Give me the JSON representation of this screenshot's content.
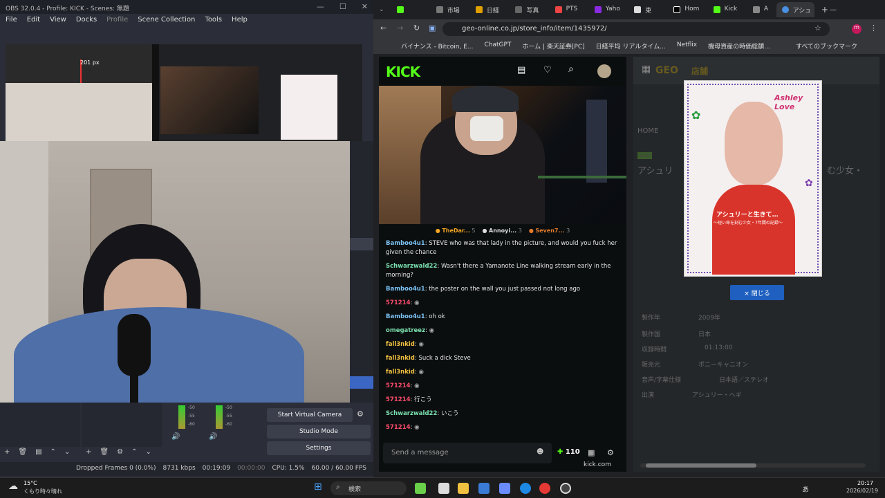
{
  "obs": {
    "title": "OBS 32.0.4 - Profile: KICK - Scenes: 無題",
    "menu": [
      "File",
      "Edit",
      "View",
      "Docks",
      "Profile",
      "Scene Collection",
      "Tools",
      "Help"
    ],
    "preview_size_label": "201 px",
    "controls": {
      "virtual_camera": "Start Virtual Camera",
      "studio_mode": "Studio Mode",
      "settings": "Settings"
    },
    "mixer_ticks": [
      "-50",
      "-55",
      "-60"
    ],
    "status": {
      "dropped_frames": "Dropped Frames 0 (0.0%)",
      "bitrate": "8731 kbps",
      "stream_time": "00:19:09",
      "rec_time": "00:00:00",
      "cpu": "CPU: 1.5%",
      "fps": "60.00 / 60.00 FPS"
    }
  },
  "browser": {
    "tabs": [
      {
        "label": "市場",
        "color": "#53fc18"
      },
      {
        "label": "日経",
        "color": "#e0a000"
      },
      {
        "label": "写真",
        "color": "#888"
      },
      {
        "label": "PTS",
        "color": "#e44"
      },
      {
        "label": "Yaho",
        "color": "#8a2be2"
      },
      {
        "label": "東",
        "color": "#ddd"
      },
      {
        "label": "Hom",
        "color": "#fff"
      },
      {
        "label": "Kick",
        "color": "#53fc18"
      },
      {
        "label": "A",
        "color": "#888"
      },
      {
        "label": "アシュ",
        "color": "#4a90e2"
      }
    ],
    "url": "geo-online.co.jp/store_info/item/1435972/",
    "bookmarks": [
      "バイナンス - Bitcoin, E...",
      "ChatGPT",
      "ホーム | 楽天証券[PC]",
      "日経平均 リアルタイム...",
      "Netflix",
      "機母資産の時価総額...",
      "すべてのブックマーク"
    ]
  },
  "kick": {
    "logo": "KICK",
    "leaders": [
      {
        "name": "TheDar...",
        "count": "5",
        "color": "#f5a623"
      },
      {
        "name": "Annoyi...",
        "count": "3",
        "color": "#ddd"
      },
      {
        "name": "Seven7...",
        "count": "3",
        "color": "#e57b2c"
      }
    ],
    "chat": [
      {
        "user": "Bamboo4u1",
        "color": "#7cc3f5",
        "text": "STEVE who was that lady in the picture, and would you fuck her given the chance"
      },
      {
        "user": "Schwarzwald22",
        "color": "#7be1b0",
        "text": "Wasn't there a Yamanote Line walking stream early in the morning?"
      },
      {
        "user": "Bamboo4u1",
        "color": "#7cc3f5",
        "text": "the poster on the wall you just passed not long ago"
      },
      {
        "user": "571214",
        "color": "#ff4d6d",
        "text": ""
      },
      {
        "user": "Bamboo4u1",
        "color": "#7cc3f5",
        "text": "oh ok"
      },
      {
        "user": "omegatreez",
        "color": "#7be1b0",
        "text": ""
      },
      {
        "user": "fall3nkid",
        "color": "#f0c040",
        "text": ""
      },
      {
        "user": "fall3nkid",
        "color": "#f0c040",
        "text": "Suck a dick Steve"
      },
      {
        "user": "fall3nkid",
        "color": "#f0c040",
        "text": ""
      },
      {
        "user": "571214",
        "color": "#ff4d6d",
        "text": ""
      },
      {
        "user": "571214",
        "color": "#ff4d6d",
        "text": "行こう"
      },
      {
        "user": "Schwarzwald22",
        "color": "#7be1b0",
        "text": "いこう"
      },
      {
        "user": "571214",
        "color": "#ff4d6d",
        "text": ""
      }
    ],
    "send_placeholder": "Send a message",
    "points": "110",
    "footer": "kick.com"
  },
  "geo": {
    "brand": "GEO",
    "store_label": "店舗",
    "home": "HOME",
    "dvd_badge": "DVD",
    "title_partial": "アシュリ",
    "title_suffix": "む少女・",
    "dvd_title": "アシュリーと生きて…",
    "dvd_sub": "〜短い命を刻む少女・7年間の記録〜",
    "dvd_top_text": "Ashley Love",
    "close_label": "× 閉じる",
    "specs": [
      {
        "k": "製作年",
        "v": "2009年"
      },
      {
        "k": "製作国",
        "v": "日本"
      },
      {
        "k": "収録時間",
        "v": "01:13:00"
      },
      {
        "k": "販売元",
        "v": "ポニーキャニオン"
      },
      {
        "k": "音声/字幕仕様",
        "v": "日本語／ステレオ"
      },
      {
        "k": "出演",
        "v": "アシュリー・ヘギ"
      }
    ]
  },
  "taskbar": {
    "weather_temp": "15°C",
    "weather_desc": "くもり時々晴れ",
    "search": "検索",
    "time": "20:17",
    "date": "2026/02/19",
    "ime": "あ"
  }
}
